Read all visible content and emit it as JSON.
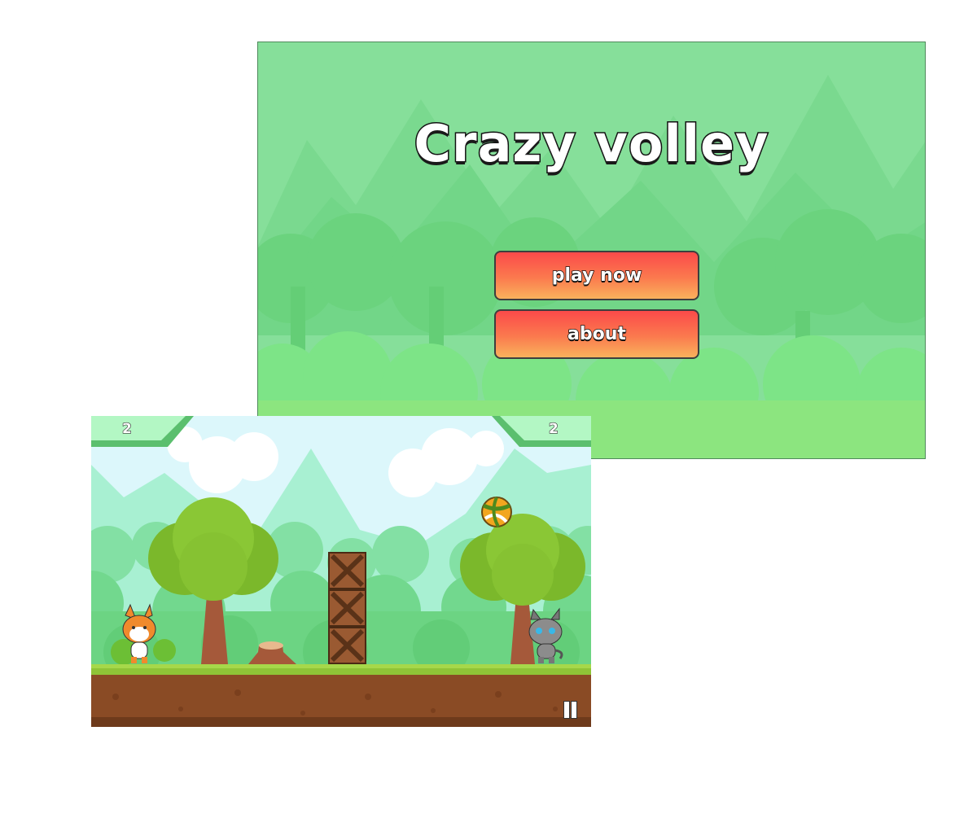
{
  "menu": {
    "title": "Crazy volley",
    "play_label": "play now",
    "about_label": "about"
  },
  "game": {
    "score_left": "2",
    "score_right": "2",
    "pause_icon": "pause-icon",
    "characters": [
      "fox-character",
      "cat-character"
    ],
    "ball": "volleyball"
  },
  "colors": {
    "menu_bg": "#86df9a",
    "button_top": "#fb4a4a",
    "button_bottom": "#f9b25c",
    "grass": "#8fce3a",
    "dirt": "#8a4b25"
  }
}
